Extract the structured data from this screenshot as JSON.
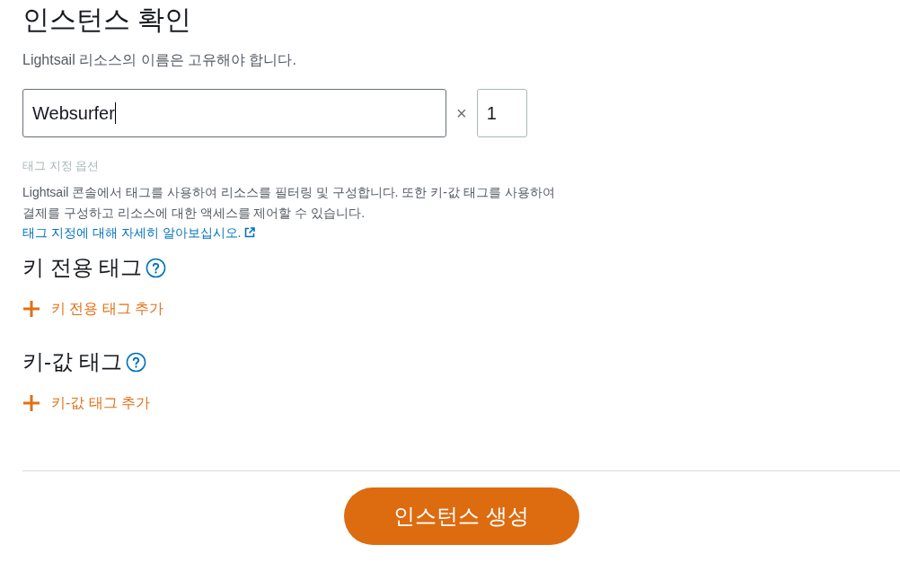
{
  "heading": "인스턴스 확인",
  "subtitle": "Lightsail 리소스의 이름은 고유해야 합니다.",
  "name_field": {
    "value": "Websurfer",
    "focused": true
  },
  "multiplier": "×",
  "count_field": {
    "value": "1"
  },
  "tagging": {
    "label": "태그 지정 옵션",
    "description": "Lightsail 콘솔에서 태그를 사용하여 리소스를 필터링 및 구성합니다. 또한 키-값 태그를 사용하여 결제를 구성하고 리소스에 대한 액세스를 제어할 수 있습니다.",
    "link": "태그 지정에 대해 자세히 알아보십시오."
  },
  "tag_sections": [
    {
      "title": "키 전용 태그",
      "add_label": "키 전용 태그 추가"
    },
    {
      "title": "키-값 태그",
      "add_label": "키-값 태그 추가"
    }
  ],
  "create_button": "인스턴스 생성"
}
